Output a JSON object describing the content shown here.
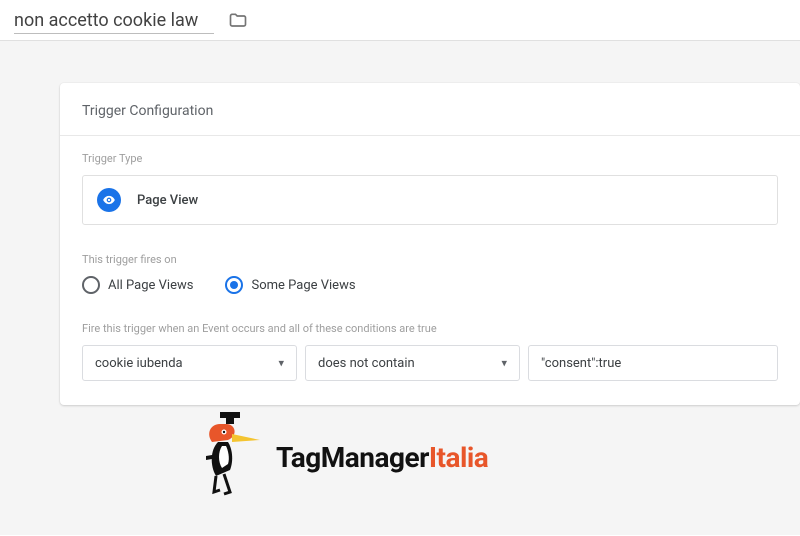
{
  "header": {
    "trigger_name": "non accetto cookie law"
  },
  "card": {
    "title": "Trigger Configuration",
    "type_label": "Trigger Type",
    "type_name": "Page View",
    "fires_on_label": "This trigger fires on",
    "radio_all": "All Page Views",
    "radio_some": "Some Page Views",
    "conditions_label": "Fire this trigger when an Event occurs and all of these conditions are true",
    "condition": {
      "variable": "cookie iubenda",
      "operator": "does not contain",
      "value": "\"consent\":true"
    }
  },
  "brand": {
    "prefix": "TagManager",
    "suffix": "Italia"
  }
}
